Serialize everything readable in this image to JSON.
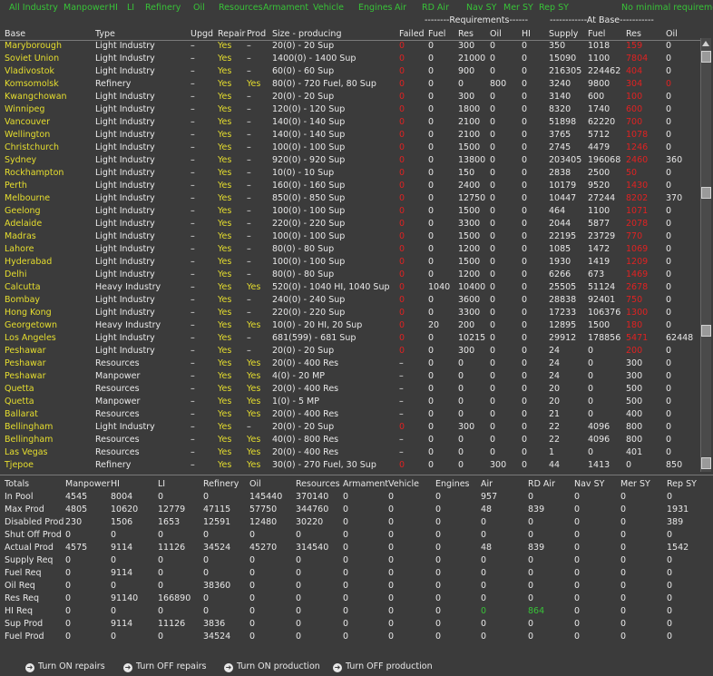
{
  "filters": [
    "All Industry",
    "Manpower",
    "HI",
    "LI",
    "Refinery",
    "Oil",
    "Resources",
    "Armament",
    "Vehicle",
    "Engines",
    "Air",
    "RD Air",
    "Nav SY",
    "Mer SY",
    "Rep SY",
    "No minimal requirement"
  ],
  "group_headers": {
    "requirements": "--------Requirements------",
    "at_base": "------------At Base-----------"
  },
  "columns": [
    "Base",
    "Type",
    "Upgd",
    "Repair",
    "Prod",
    "Size - producing",
    "Failed",
    "Fuel",
    "Res",
    "Oil",
    "HI",
    "Supply",
    "Fuel",
    "Res",
    "Oil"
  ],
  "rows": [
    [
      "Maryborough",
      "Light Industry",
      "–",
      "Yes",
      "–",
      "20(0) - 20 Sup",
      "0",
      "0",
      "300",
      "0",
      "0",
      "350",
      "1018",
      "159",
      "0"
    ],
    [
      "Soviet Union",
      "Light Industry",
      "–",
      "Yes",
      "–",
      "1400(0) - 1400 Sup",
      "0",
      "0",
      "21000",
      "0",
      "0",
      "15090",
      "1100",
      "7804",
      "0"
    ],
    [
      "Vladivostok",
      "Light Industry",
      "–",
      "Yes",
      "–",
      "60(0) - 60 Sup",
      "0",
      "0",
      "900",
      "0",
      "0",
      "216305",
      "224462",
      "404",
      "0"
    ],
    [
      "Komsomolsk",
      "Refinery",
      "–",
      "Yes",
      "Yes",
      "80(0) - 720 Fuel, 80 Sup",
      "0",
      "0",
      "0",
      "800",
      "0",
      "3240",
      "9800",
      "304",
      "0"
    ],
    [
      "Kwangchowan",
      "Light Industry",
      "–",
      "Yes",
      "–",
      "20(0) - 20 Sup",
      "0",
      "0",
      "300",
      "0",
      "0",
      "3140",
      "600",
      "100",
      "0"
    ],
    [
      "Winnipeg",
      "Light Industry",
      "–",
      "Yes",
      "–",
      "120(0) - 120 Sup",
      "0",
      "0",
      "1800",
      "0",
      "0",
      "8320",
      "1740",
      "600",
      "0"
    ],
    [
      "Vancouver",
      "Light Industry",
      "–",
      "Yes",
      "–",
      "140(0) - 140 Sup",
      "0",
      "0",
      "2100",
      "0",
      "0",
      "51898",
      "62220",
      "700",
      "0"
    ],
    [
      "Wellington",
      "Light Industry",
      "–",
      "Yes",
      "–",
      "140(0) - 140 Sup",
      "0",
      "0",
      "2100",
      "0",
      "0",
      "3765",
      "5712",
      "1078",
      "0"
    ],
    [
      "Christchurch",
      "Light Industry",
      "–",
      "Yes",
      "–",
      "100(0) - 100 Sup",
      "0",
      "0",
      "1500",
      "0",
      "0",
      "2745",
      "4479",
      "1246",
      "0"
    ],
    [
      "Sydney",
      "Light Industry",
      "–",
      "Yes",
      "–",
      "920(0) - 920 Sup",
      "0",
      "0",
      "13800",
      "0",
      "0",
      "203405",
      "196068",
      "2460",
      "360"
    ],
    [
      "Rockhampton",
      "Light Industry",
      "–",
      "Yes",
      "–",
      "10(0) - 10 Sup",
      "0",
      "0",
      "150",
      "0",
      "0",
      "2838",
      "2500",
      "50",
      "0"
    ],
    [
      "Perth",
      "Light Industry",
      "–",
      "Yes",
      "–",
      "160(0) - 160 Sup",
      "0",
      "0",
      "2400",
      "0",
      "0",
      "10179",
      "9520",
      "1430",
      "0"
    ],
    [
      "Melbourne",
      "Light Industry",
      "–",
      "Yes",
      "–",
      "850(0) - 850 Sup",
      "0",
      "0",
      "12750",
      "0",
      "0",
      "10447",
      "27244",
      "8202",
      "370"
    ],
    [
      "Geelong",
      "Light Industry",
      "–",
      "Yes",
      "–",
      "100(0) - 100 Sup",
      "0",
      "0",
      "1500",
      "0",
      "0",
      "464",
      "1100",
      "1071",
      "0"
    ],
    [
      "Adelaide",
      "Light Industry",
      "–",
      "Yes",
      "–",
      "220(0) - 220 Sup",
      "0",
      "0",
      "3300",
      "0",
      "0",
      "2044",
      "5877",
      "2078",
      "0"
    ],
    [
      "Madras",
      "Light Industry",
      "–",
      "Yes",
      "–",
      "100(0) - 100 Sup",
      "0",
      "0",
      "1500",
      "0",
      "0",
      "22195",
      "23729",
      "770",
      "0"
    ],
    [
      "Lahore",
      "Light Industry",
      "–",
      "Yes",
      "–",
      "80(0) - 80 Sup",
      "0",
      "0",
      "1200",
      "0",
      "0",
      "1085",
      "1472",
      "1069",
      "0"
    ],
    [
      "Hyderabad",
      "Light Industry",
      "–",
      "Yes",
      "–",
      "100(0) - 100 Sup",
      "0",
      "0",
      "1500",
      "0",
      "0",
      "1930",
      "1419",
      "1209",
      "0"
    ],
    [
      "Delhi",
      "Light Industry",
      "–",
      "Yes",
      "–",
      "80(0) - 80 Sup",
      "0",
      "0",
      "1200",
      "0",
      "0",
      "6266",
      "673",
      "1469",
      "0"
    ],
    [
      "Calcutta",
      "Heavy Industry",
      "–",
      "Yes",
      "Yes",
      "520(0) - 1040 HI, 1040 Sup",
      "0",
      "1040",
      "10400",
      "0",
      "0",
      "25505",
      "51124",
      "2678",
      "0"
    ],
    [
      "Bombay",
      "Light Industry",
      "–",
      "Yes",
      "–",
      "240(0) - 240 Sup",
      "0",
      "0",
      "3600",
      "0",
      "0",
      "28838",
      "92401",
      "750",
      "0"
    ],
    [
      "Hong Kong",
      "Light Industry",
      "–",
      "Yes",
      "–",
      "220(0) - 220 Sup",
      "0",
      "0",
      "3300",
      "0",
      "0",
      "17233",
      "106376",
      "1300",
      "0"
    ],
    [
      "Georgetown",
      "Heavy Industry",
      "–",
      "Yes",
      "Yes",
      "10(0) - 20 HI, 20 Sup",
      "0",
      "20",
      "200",
      "0",
      "0",
      "12895",
      "1500",
      "180",
      "0"
    ],
    [
      "Los Angeles",
      "Light Industry",
      "–",
      "Yes",
      "–",
      "681(599) - 681 Sup",
      "0",
      "0",
      "10215",
      "0",
      "0",
      "29912",
      "178856",
      "5471",
      "62448"
    ],
    [
      "Peshawar",
      "Light Industry",
      "–",
      "Yes",
      "–",
      "20(0) - 20 Sup",
      "0",
      "0",
      "300",
      "0",
      "0",
      "24",
      "0",
      "200",
      "0"
    ],
    [
      "Peshawar",
      "Resources",
      "–",
      "Yes",
      "Yes",
      "20(0) - 400 Res",
      "–",
      "0",
      "0",
      "0",
      "0",
      "24",
      "0",
      "300",
      "0"
    ],
    [
      "Peshawar",
      "Manpower",
      "–",
      "Yes",
      "Yes",
      "4(0) - 20 MP",
      "–",
      "0",
      "0",
      "0",
      "0",
      "24",
      "0",
      "300",
      "0"
    ],
    [
      "Quetta",
      "Resources",
      "–",
      "Yes",
      "Yes",
      "20(0) - 400 Res",
      "–",
      "0",
      "0",
      "0",
      "0",
      "20",
      "0",
      "500",
      "0"
    ],
    [
      "Quetta",
      "Manpower",
      "–",
      "Yes",
      "Yes",
      "1(0) - 5 MP",
      "–",
      "0",
      "0",
      "0",
      "0",
      "20",
      "0",
      "500",
      "0"
    ],
    [
      "Ballarat",
      "Resources",
      "–",
      "Yes",
      "Yes",
      "20(0) - 400 Res",
      "–",
      "0",
      "0",
      "0",
      "0",
      "21",
      "0",
      "400",
      "0"
    ],
    [
      "Bellingham",
      "Light Industry",
      "–",
      "Yes",
      "–",
      "20(0) - 20 Sup",
      "0",
      "0",
      "300",
      "0",
      "0",
      "22",
      "4096",
      "800",
      "0"
    ],
    [
      "Bellingham",
      "Resources",
      "–",
      "Yes",
      "Yes",
      "40(0) - 800 Res",
      "–",
      "0",
      "0",
      "0",
      "0",
      "22",
      "4096",
      "800",
      "0"
    ],
    [
      "Las Vegas",
      "Resources",
      "–",
      "Yes",
      "Yes",
      "20(0) - 400 Res",
      "–",
      "0",
      "0",
      "0",
      "0",
      "1",
      "0",
      "401",
      "0"
    ],
    [
      "Tjepoe",
      "Refinery",
      "–",
      "Yes",
      "Yes",
      "30(0) - 270 Fuel, 30 Sup",
      "0",
      "0",
      "0",
      "300",
      "0",
      "44",
      "1413",
      "0",
      "850"
    ]
  ],
  "totals": {
    "headers": [
      "Totals",
      "Manpower",
      "HI",
      "LI",
      "Refinery",
      "Oil",
      "Resources",
      "Armament",
      "Vehicle",
      "Engines",
      "Air",
      "RD Air",
      "Nav SY",
      "Mer SY",
      "Rep SY"
    ],
    "rows": [
      [
        "In Pool",
        "4545",
        "8004",
        "0",
        "0",
        "145440",
        "370140",
        "0",
        "0",
        "0",
        "957",
        "0",
        "0",
        "0",
        "0"
      ],
      [
        "Max Prod",
        "4805",
        "10620",
        "12779",
        "47115",
        "57750",
        "344760",
        "0",
        "0",
        "0",
        "48",
        "839",
        "0",
        "0",
        "1931"
      ],
      [
        "Disabled Prod",
        "230",
        "1506",
        "1653",
        "12591",
        "12480",
        "30220",
        "0",
        "0",
        "0",
        "0",
        "0",
        "0",
        "0",
        "389"
      ],
      [
        "Shut Off Prod",
        "0",
        "0",
        "0",
        "0",
        "0",
        "0",
        "0",
        "0",
        "0",
        "0",
        "0",
        "0",
        "0",
        "0"
      ],
      [
        "Actual Prod",
        "4575",
        "9114",
        "11126",
        "34524",
        "45270",
        "314540",
        "0",
        "0",
        "0",
        "48",
        "839",
        "0",
        "0",
        "1542"
      ],
      [
        "Supply Req",
        "0",
        "0",
        "0",
        "0",
        "0",
        "0",
        "0",
        "0",
        "0",
        "0",
        "0",
        "0",
        "0",
        "0"
      ],
      [
        "Fuel Req",
        "0",
        "9114",
        "0",
        "0",
        "0",
        "0",
        "0",
        "0",
        "0",
        "0",
        "0",
        "0",
        "0",
        "0"
      ],
      [
        "Oil Req",
        "0",
        "0",
        "0",
        "38360",
        "0",
        "0",
        "0",
        "0",
        "0",
        "0",
        "0",
        "0",
        "0",
        "0"
      ],
      [
        "Res Req",
        "0",
        "91140",
        "166890",
        "0",
        "0",
        "0",
        "0",
        "0",
        "0",
        "0",
        "0",
        "0",
        "0",
        "0"
      ],
      [
        "HI Req",
        "0",
        "0",
        "0",
        "0",
        "0",
        "0",
        "0",
        "0",
        "0",
        "0",
        "864",
        "0",
        "0",
        "0"
      ],
      [
        "Sup Prod",
        "0",
        "9114",
        "11126",
        "3836",
        "0",
        "0",
        "0",
        "0",
        "0",
        "0",
        "0",
        "0",
        "0",
        "0"
      ],
      [
        "Fuel Prod",
        "0",
        "0",
        "0",
        "34524",
        "0",
        "0",
        "0",
        "0",
        "0",
        "0",
        "0",
        "0",
        "0",
        "0"
      ]
    ]
  },
  "footer_buttons": [
    "Turn ON repairs",
    "Turn OFF repairs",
    "Turn ON production",
    "Turn OFF production"
  ],
  "colors": {
    "background": "#3b3b3b",
    "filter_green": "#38c238",
    "base_yellow": "#e6de2e",
    "alert_red": "#e02222",
    "text": "#e8e8e8"
  }
}
